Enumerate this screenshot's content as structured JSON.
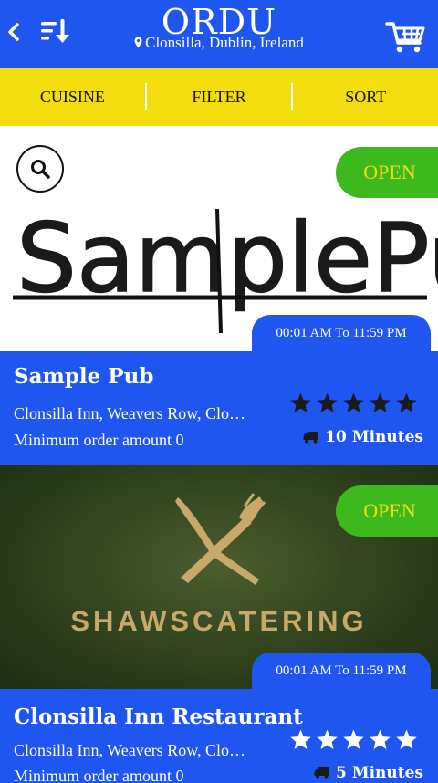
{
  "app": {
    "brand": "ORDU",
    "location": "Clonsilla, Dublin, Ireland"
  },
  "tabs": [
    {
      "label": "CUISINE"
    },
    {
      "label": "FILTER"
    },
    {
      "label": "SORT"
    }
  ],
  "restaurants": [
    {
      "logo_text": "SamplePub",
      "status": "OPEN",
      "hours": "00:01 AM To 11:59 PM",
      "name": "Sample Pub",
      "address": "Clonsilla Inn, Weavers Row, Clonsilla",
      "min_order": "Minimum order amount 0",
      "rating": 5,
      "delivery_time": "10 Minutes"
    },
    {
      "logo_text": "SHAWSCATERING",
      "status": "OPEN",
      "hours": "00:01 AM To 11:59 PM",
      "name": "Clonsilla Inn Restaurant",
      "address": "Clonsilla Inn, Weavers Row, Clonsilla",
      "min_order": "Minimum order amount 0",
      "rating": 5,
      "delivery_time": "5 Minutes"
    }
  ],
  "icons": {
    "back": "chevron-left-icon",
    "sort": "sort-descending-icon",
    "cart": "cart-icon",
    "pin": "map-pin-icon",
    "search": "search-icon",
    "star": "star-icon",
    "truck": "truck-icon",
    "cutlery": "fork-knife-icon"
  },
  "colors": {
    "primary": "#1f56f0",
    "accent": "#f4dd0f",
    "open_badge": "#3db81d",
    "open_text": "#f4dd0f"
  }
}
